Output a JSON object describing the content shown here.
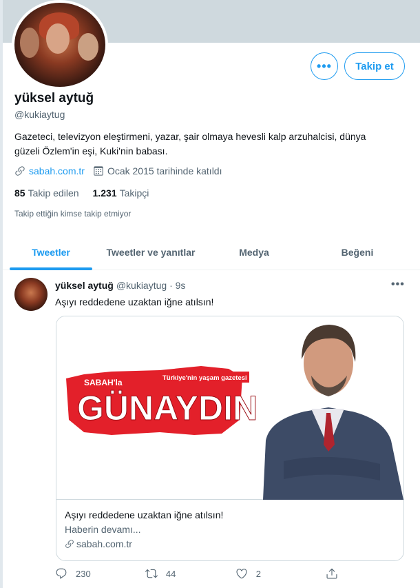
{
  "profile": {
    "name": "yüksel aytuğ",
    "handle": "@kukiaytug",
    "bio_line1": "Gazeteci, televizyon eleştirmeni, yazar, şair olmaya hevesli kalp arzuhalcisi, dünya",
    "bio_line2": "güzeli Özlem'in eşi,  Kuki'nin babası.",
    "website": "sabah.com.tr",
    "joined": "Ocak 2015 tarihinde katıldı",
    "following_count": "85",
    "following_label": "Takip edilen",
    "followers_count": "1.231",
    "followers_label": "Takipçi",
    "notice": "Takip ettiğin kimse takip etmiyor"
  },
  "buttons": {
    "more": "•••",
    "follow": "Takip et"
  },
  "tabs": [
    {
      "label": "Tweetler"
    },
    {
      "label": "Tweetler ve yanıtlar"
    },
    {
      "label": "Medya"
    },
    {
      "label": "Beğeni"
    }
  ],
  "tweet": {
    "author": "yüksel aytuğ",
    "handle_time": "@kukiaytug · 9s",
    "more": "•••",
    "text": "Aşıyı reddedene uzaktan iğne atılsın!",
    "card": {
      "image_tagline": "Türkiye'nin yaşam gazetesi",
      "image_brand": "SABAH'la",
      "image_headline": "GÜNAYDIN",
      "title": "Aşıyı reddedene uzaktan iğne atılsın!",
      "description": "Haberin devamı...",
      "domain": "sabah.com.tr"
    },
    "replies": "230",
    "retweets": "44",
    "likes": "2"
  },
  "colors": {
    "accent": "#1d9bf0",
    "banner": "#cfd9de",
    "text_secondary": "#536471",
    "headline_red": "#e3202a"
  }
}
